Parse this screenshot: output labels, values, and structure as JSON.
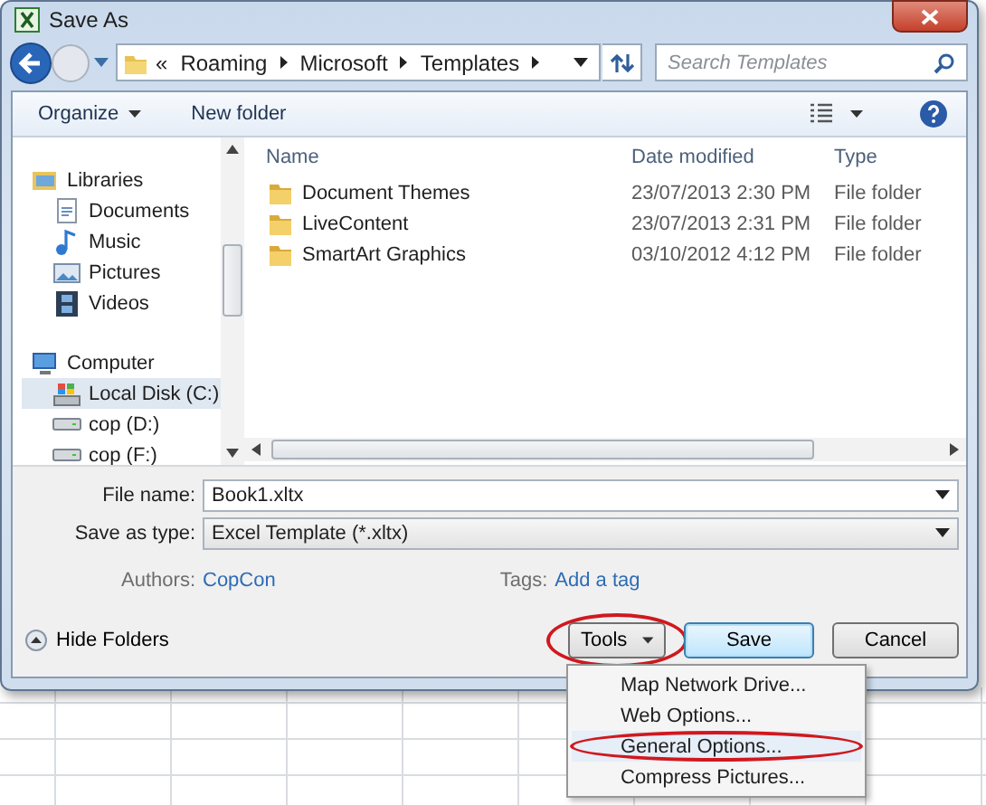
{
  "window": {
    "title": "Save As"
  },
  "address": {
    "overflow": "«",
    "path": [
      "Roaming",
      "Microsoft",
      "Templates"
    ]
  },
  "search": {
    "placeholder": "Search Templates"
  },
  "toolbar": {
    "organize": "Organize",
    "new_folder": "New folder"
  },
  "nav": [
    {
      "label": "Libraries",
      "kind": "libraries",
      "selected": false,
      "children": [
        {
          "label": "Documents",
          "kind": "documents",
          "selected": false
        },
        {
          "label": "Music",
          "kind": "music",
          "selected": false
        },
        {
          "label": "Pictures",
          "kind": "pictures",
          "selected": false
        },
        {
          "label": "Videos",
          "kind": "videos",
          "selected": false
        }
      ]
    },
    {
      "label": "Computer",
      "kind": "computer",
      "selected": false,
      "children": [
        {
          "label": "Local Disk (C:)",
          "kind": "system-drive",
          "selected": true
        },
        {
          "label": "cop (D:)",
          "kind": "drive",
          "selected": false
        },
        {
          "label": "cop (F:)",
          "kind": "drive",
          "selected": false
        }
      ]
    }
  ],
  "columns": [
    "Name",
    "Date modified",
    "Type"
  ],
  "files": [
    {
      "name": "Document Themes",
      "date": "23/07/2013 2:30 PM",
      "type": "File folder"
    },
    {
      "name": "LiveContent",
      "date": "23/07/2013 2:31 PM",
      "type": "File folder"
    },
    {
      "name": "SmartArt Graphics",
      "date": "03/10/2012 4:12 PM",
      "type": "File folder"
    }
  ],
  "file_name": {
    "label": "File name:",
    "value": "Book1.xltx"
  },
  "save_type": {
    "label": "Save as type:",
    "value": "Excel Template (*.xltx)"
  },
  "authors": {
    "label": "Authors:",
    "value": "CopCon"
  },
  "tags": {
    "label": "Tags:",
    "value": "Add a tag"
  },
  "hide_folders": "Hide Folders",
  "buttons": [
    {
      "label": "Tools",
      "kind": "menu",
      "highlighted": true
    },
    {
      "label": "Save",
      "kind": "default",
      "highlighted": false
    },
    {
      "label": "Cancel",
      "kind": "plain",
      "highlighted": false
    }
  ],
  "menu": [
    {
      "label": "Map Network Drive...",
      "highlighted": false
    },
    {
      "label": "Web Options...",
      "highlighted": false
    },
    {
      "label": "General Options...",
      "highlighted": true
    },
    {
      "label": "Compress Pictures...",
      "highlighted": false
    }
  ]
}
